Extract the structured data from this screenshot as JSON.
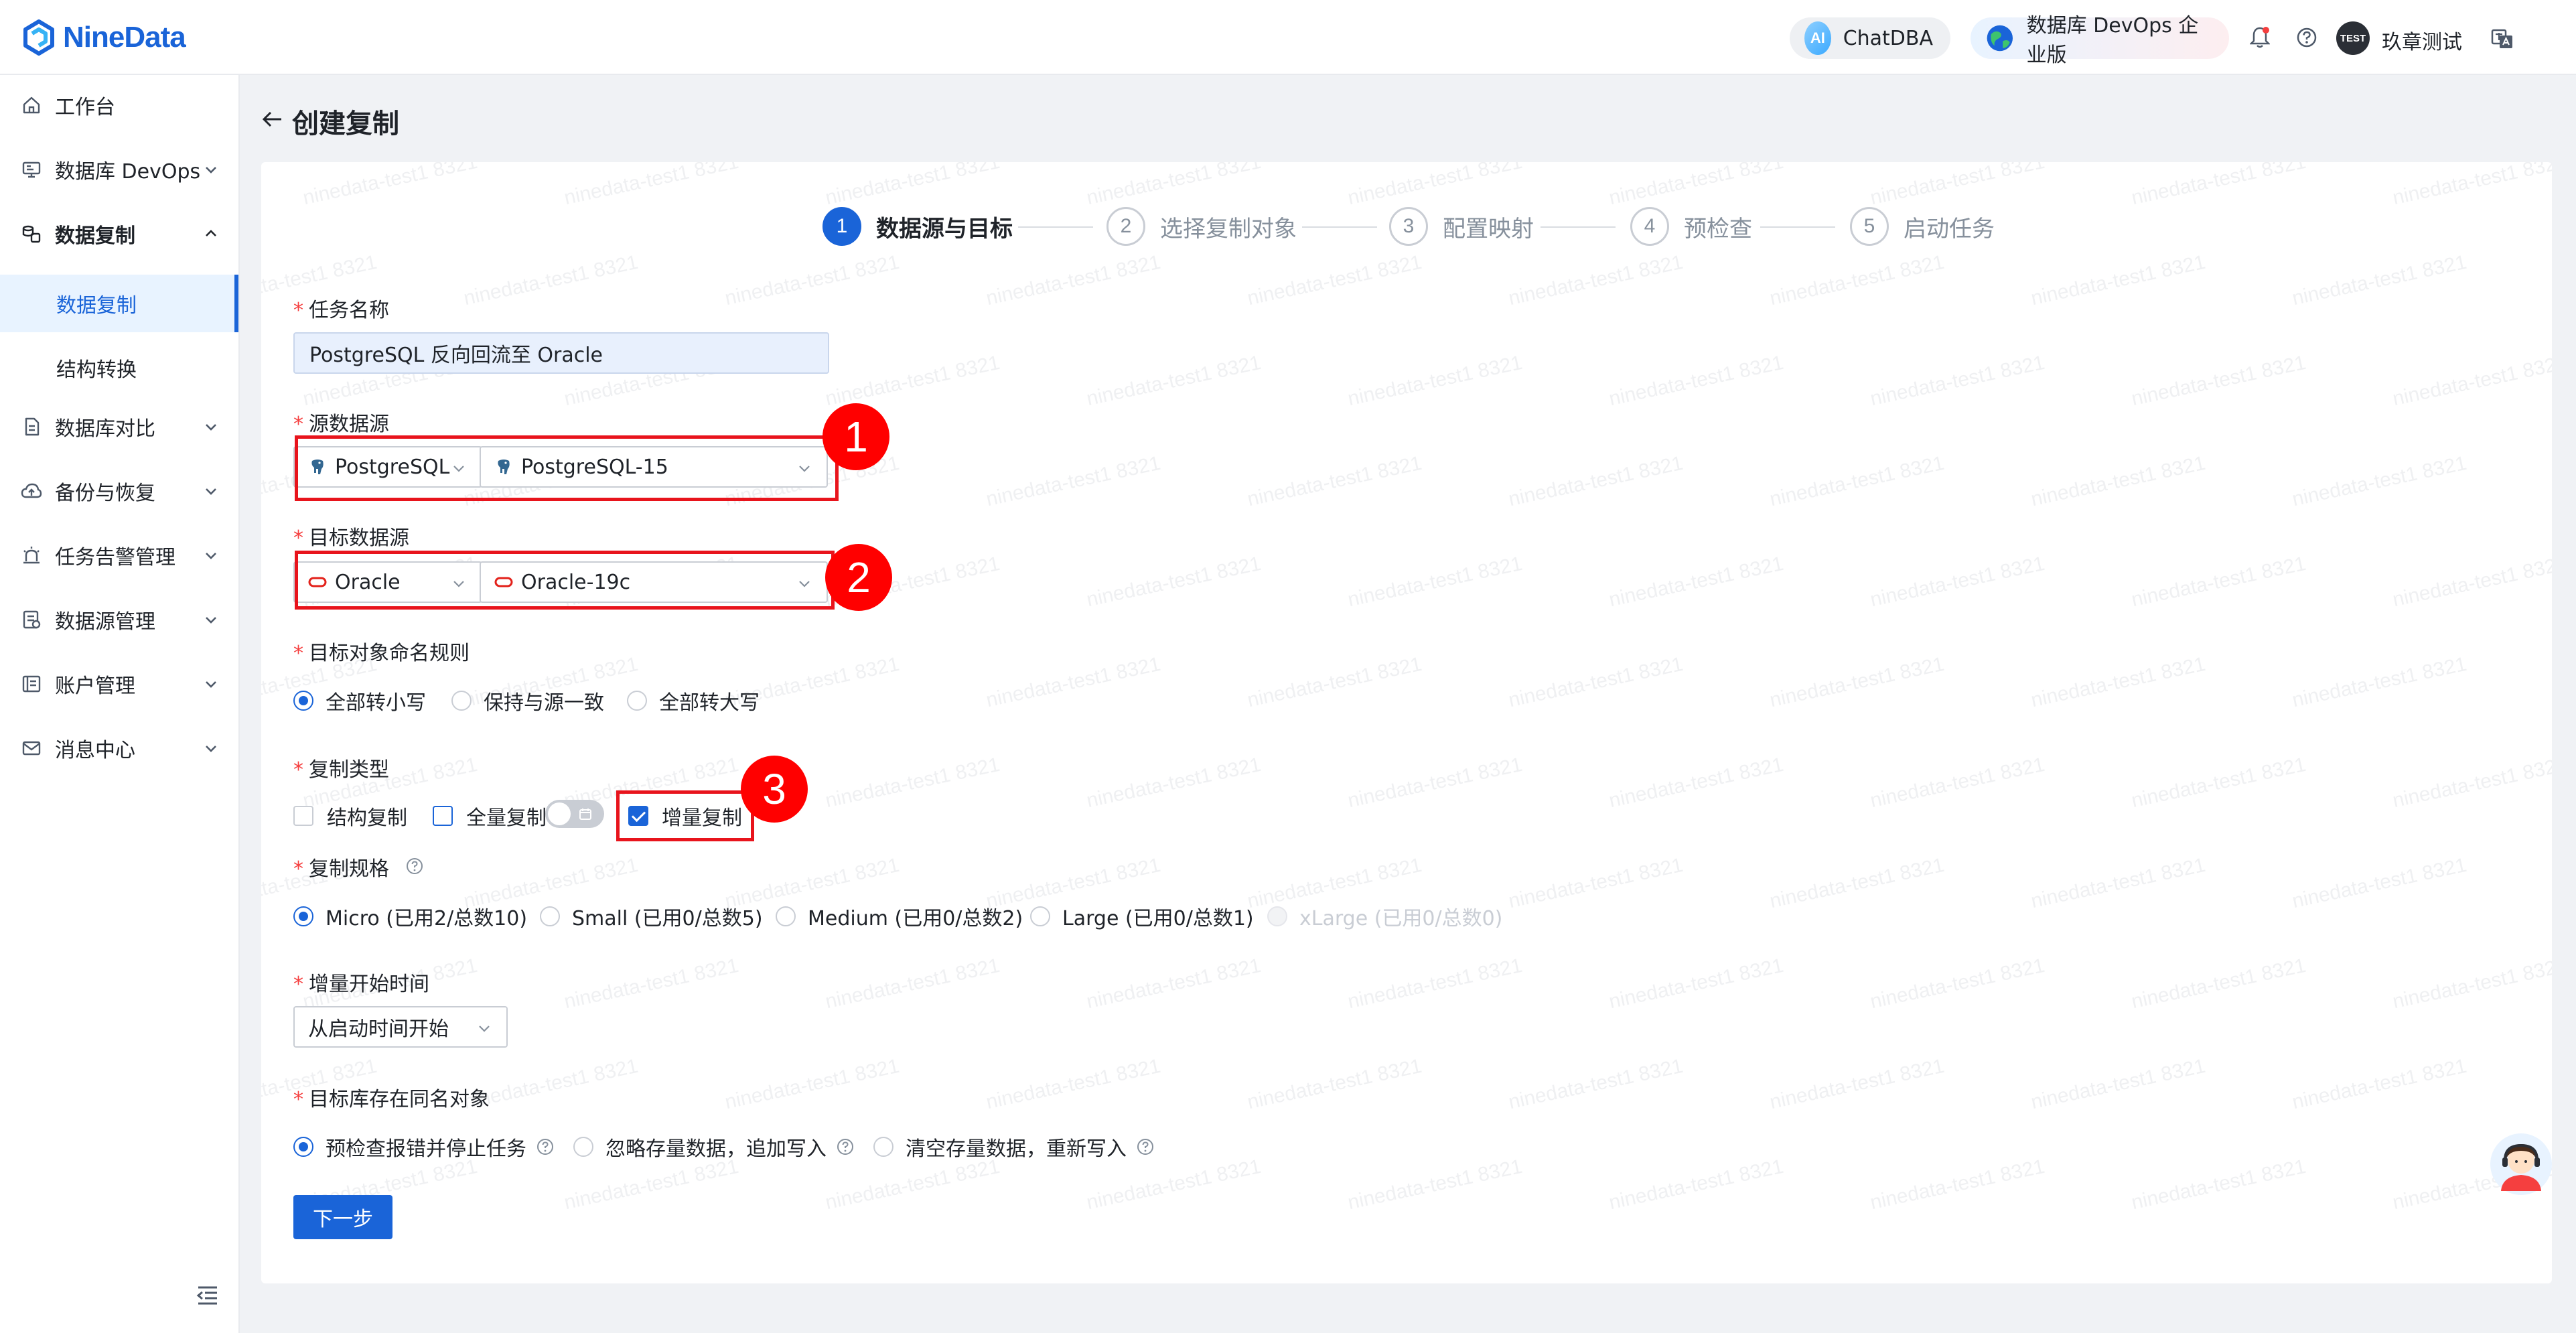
{
  "header": {
    "logo_text": "NineData",
    "chat_label": "ChatDBA",
    "ai_badge": "AI",
    "devops_label": "数据库 DevOps 企业版",
    "avatar_text": "TEST",
    "username": "玖章测试"
  },
  "sidebar": {
    "items": [
      {
        "label": "工作台"
      },
      {
        "label": "数据库 DevOps"
      },
      {
        "label": "数据复制"
      },
      {
        "label": "数据库对比"
      },
      {
        "label": "备份与恢复"
      },
      {
        "label": "任务告警管理"
      },
      {
        "label": "数据源管理"
      },
      {
        "label": "账户管理"
      },
      {
        "label": "消息中心"
      }
    ],
    "sub_items": [
      {
        "label": "数据复制"
      },
      {
        "label": "结构转换"
      }
    ]
  },
  "page": {
    "title": "创建复制"
  },
  "steps": [
    {
      "num": "1",
      "label": "数据源与目标"
    },
    {
      "num": "2",
      "label": "选择复制对象"
    },
    {
      "num": "3",
      "label": "配置映射"
    },
    {
      "num": "4",
      "label": "预检查"
    },
    {
      "num": "5",
      "label": "启动任务"
    }
  ],
  "form": {
    "task_name": {
      "label": "任务名称",
      "value": "PostgreSQL 反向回流至 Oracle"
    },
    "source": {
      "label": "源数据源",
      "type": "PostgreSQL",
      "instance": "PostgreSQL-15"
    },
    "target": {
      "label": "目标数据源",
      "type": "Oracle",
      "instance": "Oracle-19c"
    },
    "naming": {
      "label": "目标对象命名规则",
      "options": [
        "全部转小写",
        "保持与源一致",
        "全部转大写"
      ],
      "selected": "全部转小写"
    },
    "copy_type": {
      "label": "复制类型",
      "options": [
        "结构复制",
        "全量复制",
        "增量复制"
      ],
      "checked": [
        "增量复制"
      ]
    },
    "spec": {
      "label": "复制规格",
      "options": [
        "Micro (已用2/总数10)",
        "Small (已用0/总数5)",
        "Medium (已用0/总数2)",
        "Large (已用0/总数1)",
        "xLarge (已用0/总数0)"
      ],
      "selected": "Micro (已用2/总数10)",
      "disabled": [
        "xLarge (已用0/总数0)"
      ]
    },
    "start_time": {
      "label": "增量开始时间",
      "value": "从启动时间开始"
    },
    "conflict": {
      "label": "目标库存在同名对象",
      "options": [
        "预检查报错并停止任务",
        "忽略存量数据，追加写入",
        "清空存量数据，重新写入"
      ],
      "selected": "预检查报错并停止任务"
    },
    "next_button": "下一步"
  },
  "annotations": [
    "1",
    "2",
    "3"
  ],
  "watermark": "ninedata-test1 8321",
  "colors": {
    "primary": "#1a64d8",
    "annotation": "#e8141c",
    "required": "#f53f3f"
  }
}
